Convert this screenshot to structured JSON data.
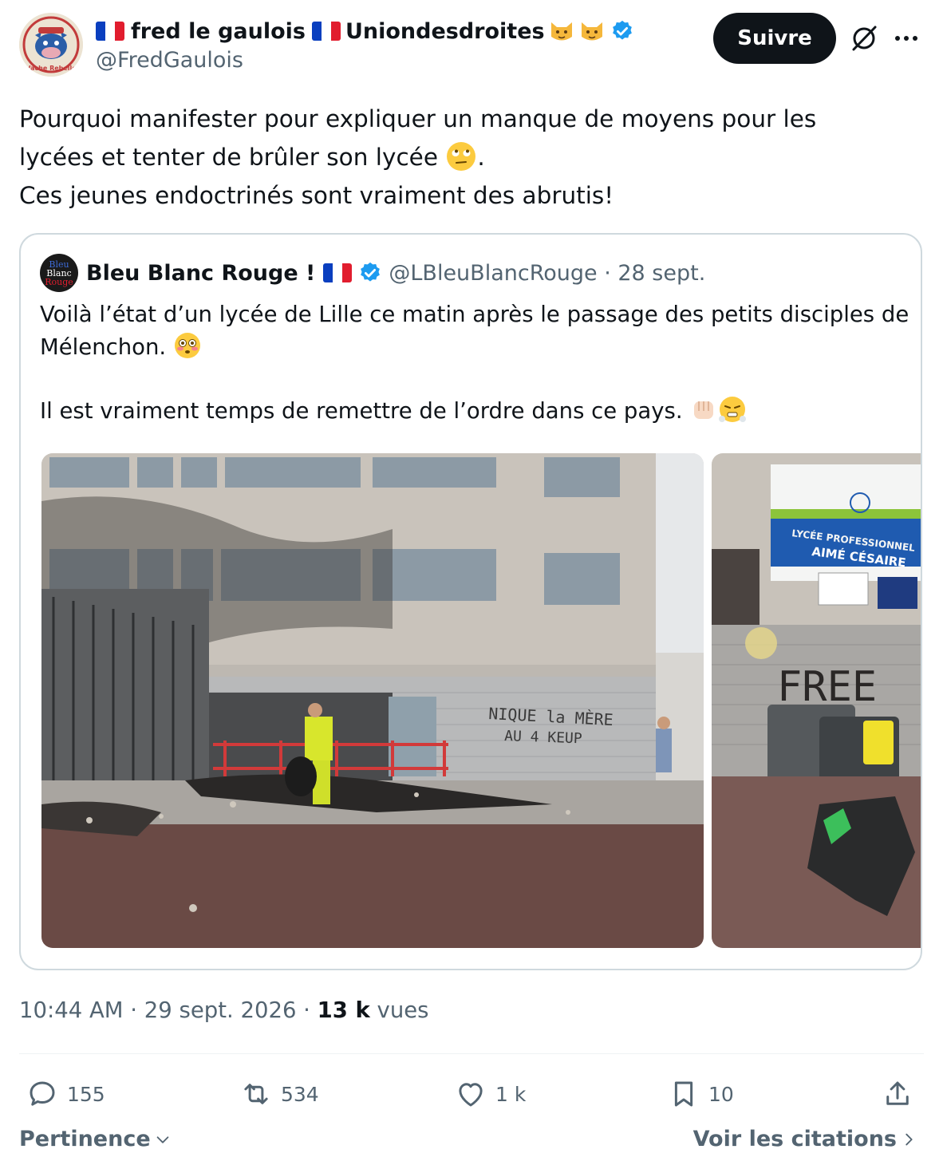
{
  "author": {
    "name_part1": "fred le gaulois",
    "name_part2": "Uniondesdroites",
    "handle": "@FredGaulois",
    "badge_emojis": [
      "cat-face",
      "cat-face"
    ],
    "verified": true,
    "avatar_text": "Vache Rebelle"
  },
  "follow_label": "Suivre",
  "tweet": {
    "line1": "Pourquoi manifester pour expliquer un manque de moyens pour les",
    "line2_prefix": "lycées et  tenter de brûler son lycée ",
    "line2_suffix": ".",
    "line3": "Ces jeunes endoctrinés sont vraiment des abrutis!"
  },
  "quote": {
    "avatar_lines": [
      "Bleu",
      "Blanc",
      "Rouge"
    ],
    "name": "Bleu Blanc Rouge !",
    "handle_date": "@LBleuBlancRouge · 28 sept.",
    "line1": "Voilà l’état d’un lycée de Lille ce matin après le passage des petits disciples de",
    "line2": "Mélenchon. ",
    "line3": "Il est vraiment temps de remettre de l’ordre dans ce pays. ",
    "photo1": {
      "graffiti_line1": "NIQUE la MÈRE",
      "graffiti_line2": "AU 4 KEUP"
    },
    "photo2": {
      "sign_line1": "LYCÉE PROFESSIONNEL",
      "sign_line2": "AIMÉ CÉSAIRE",
      "graffiti": "FREE"
    }
  },
  "meta": {
    "time_date": "10:44 AM · 29 sept. 2026 · ",
    "views_count": "13 k",
    "views_label": " vues"
  },
  "actions": {
    "replies": "155",
    "reposts": "534",
    "likes": "1 k",
    "bookmarks": "10"
  },
  "footer": {
    "sort_label": "Pertinence",
    "quotes_label": "Voir les citations"
  },
  "colors": {
    "text": "#0f1419",
    "secondary": "#536471",
    "border": "#cfd9de",
    "verified": "#1d9bf0",
    "button": "#0f1419"
  }
}
